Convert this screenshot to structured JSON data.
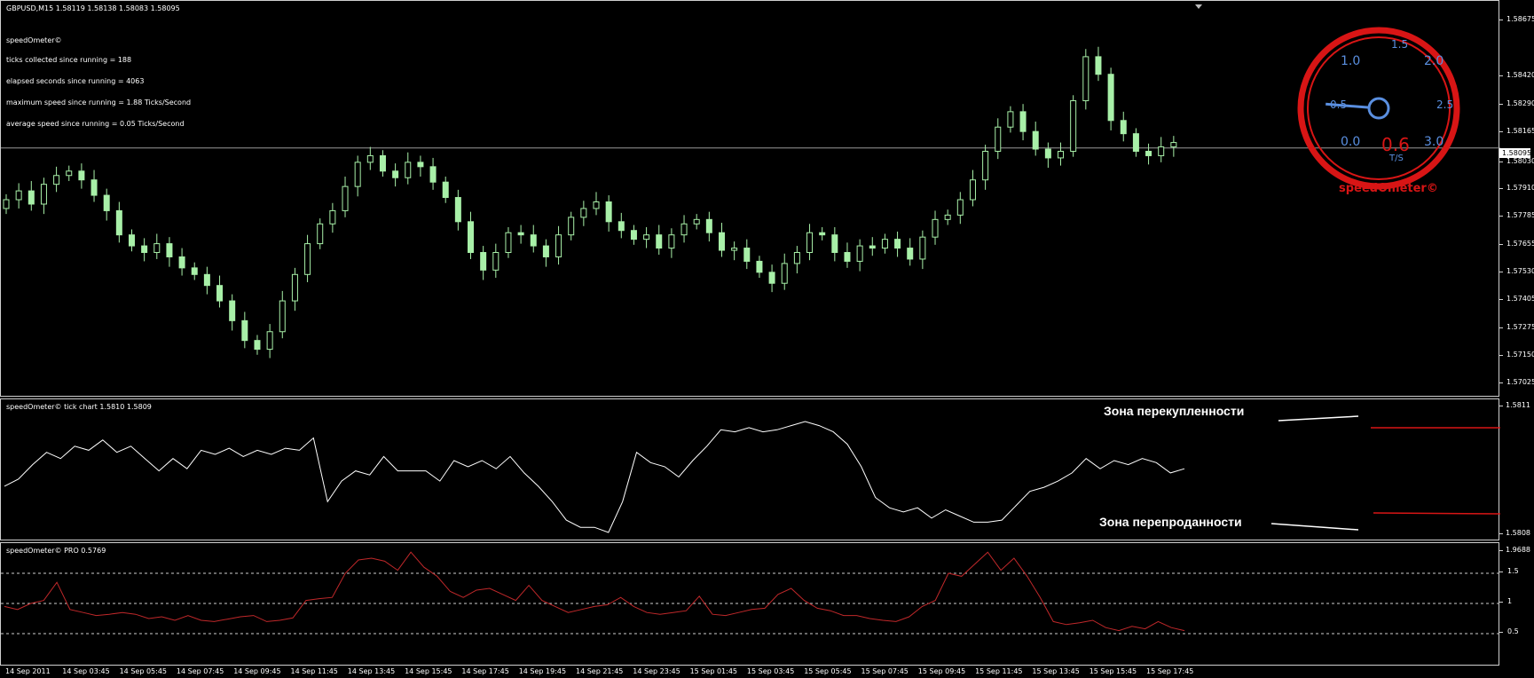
{
  "chart_data": [
    {
      "type": "candlestick",
      "title": "GBPUSD,M15  1.58119 1.58138 1.58083 1.58095",
      "current_price": "1.58095",
      "price_scale": [
        "1.58675",
        "1.58420",
        "1.58290",
        "1.58165",
        "1.58030",
        "1.57910",
        "1.57785",
        "1.57655",
        "1.57530",
        "1.57405",
        "1.57275",
        "1.57150",
        "1.57025"
      ],
      "close_series": [
        1.5786,
        1.579,
        1.5784,
        1.5793,
        1.5797,
        1.5799,
        1.5795,
        1.5788,
        1.5781,
        1.577,
        1.5765,
        1.5762,
        1.5766,
        1.576,
        1.5755,
        1.5752,
        1.5747,
        1.574,
        1.5731,
        1.5722,
        1.5718,
        1.5726,
        1.574,
        1.5752,
        1.5766,
        1.5775,
        1.5781,
        1.5792,
        1.5803,
        1.5806,
        1.5799,
        1.5796,
        1.5803,
        1.5801,
        1.5794,
        1.5787,
        1.5776,
        1.5762,
        1.5754,
        1.5762,
        1.5771,
        1.577,
        1.5765,
        1.576,
        1.577,
        1.5778,
        1.5782,
        1.5785,
        1.5776,
        1.5772,
        1.5768,
        1.577,
        1.5764,
        1.577,
        1.5775,
        1.5777,
        1.5771,
        1.5763,
        1.5764,
        1.5758,
        1.5753,
        1.5748,
        1.5757,
        1.5762,
        1.5771,
        1.577,
        1.5762,
        1.5758,
        1.5765,
        1.5764,
        1.5768,
        1.5764,
        1.5759,
        1.5769,
        1.5777,
        1.5779,
        1.5786,
        1.5795,
        1.5808,
        1.5819,
        1.5826,
        1.5817,
        1.5809,
        1.5805,
        1.5808,
        1.5831,
        1.5851,
        1.5843,
        1.5822,
        1.5816,
        1.5808,
        1.5806,
        1.581,
        1.5812
      ],
      "panel_texts": [
        "speedOmeter©",
        "ticks collected since running = 188",
        "elapsed seconds since running = 4063",
        "maximum speed since running = 1.88 Ticks/Second",
        "average speed since running = 0.05 Ticks/Second"
      ]
    },
    {
      "type": "line",
      "title": "speedOmeter© tick chart 1.5810 1.5809",
      "scale": [
        "1.5811",
        "1.5808"
      ],
      "zone_overbought": "Зона перекупленности",
      "zone_oversold": "Зона перепроданности",
      "series": [
        {
          "values": [
            0.45,
            0.52,
            0.66,
            0.78,
            0.72,
            0.84,
            0.8,
            0.9,
            0.78,
            0.84,
            0.72,
            0.6,
            0.72,
            0.62,
            0.8,
            0.76,
            0.82,
            0.74,
            0.8,
            0.76,
            0.82,
            0.8,
            0.92,
            0.3,
            0.5,
            0.6,
            0.56,
            0.74,
            0.6,
            0.6,
            0.6,
            0.5,
            0.7,
            0.64,
            0.7,
            0.62,
            0.74,
            0.58,
            0.45,
            0.3,
            0.12,
            0.05,
            0.05,
            0.0,
            0.3,
            0.78,
            0.68,
            0.64,
            0.54,
            0.7,
            0.84,
            1.0,
            0.98,
            1.02,
            0.98,
            1.0,
            1.04,
            1.08,
            1.04,
            0.98,
            0.86,
            0.64,
            0.34,
            0.24,
            0.2,
            0.24,
            0.14,
            0.22,
            0.16,
            0.1,
            0.1,
            0.12,
            0.26,
            0.4,
            0.44,
            0.5,
            0.58,
            0.72,
            0.62,
            0.7,
            0.66,
            0.72,
            0.68,
            0.58,
            0.62
          ]
        }
      ]
    },
    {
      "type": "line",
      "title": "speedOmeter© PRO 0.5769",
      "scale": [
        "1.9688",
        "1.5",
        "1",
        "0.5"
      ],
      "series": [
        {
          "values": [
            0.95,
            0.9,
            1.0,
            1.05,
            1.35,
            0.9,
            0.85,
            0.8,
            0.82,
            0.85,
            0.82,
            0.75,
            0.78,
            0.72,
            0.8,
            0.72,
            0.7,
            0.74,
            0.78,
            0.8,
            0.7,
            0.72,
            0.76,
            1.05,
            1.08,
            1.1,
            1.5,
            1.72,
            1.75,
            1.7,
            1.55,
            1.85,
            1.6,
            1.45,
            1.2,
            1.1,
            1.22,
            1.25,
            1.15,
            1.05,
            1.3,
            1.05,
            0.95,
            0.85,
            0.9,
            0.95,
            0.98,
            1.1,
            0.95,
            0.85,
            0.82,
            0.85,
            0.88,
            1.12,
            0.82,
            0.8,
            0.85,
            0.9,
            0.92,
            1.15,
            1.25,
            1.05,
            0.92,
            0.88,
            0.8,
            0.8,
            0.75,
            0.72,
            0.7,
            0.78,
            0.95,
            1.05,
            1.5,
            1.45,
            1.65,
            1.85,
            1.55,
            1.75,
            1.45,
            1.1,
            0.7,
            0.65,
            0.68,
            0.72,
            0.6,
            0.55,
            0.62,
            0.58,
            0.7,
            0.6,
            0.55
          ]
        }
      ]
    }
  ],
  "time_axis": [
    "14 Sep 2011",
    "14 Sep 03:45",
    "14 Sep 05:45",
    "14 Sep 07:45",
    "14 Sep 09:45",
    "14 Sep 11:45",
    "14 Sep 13:45",
    "14 Sep 15:45",
    "14 Sep 17:45",
    "14 Sep 19:45",
    "14 Sep 21:45",
    "14 Sep 23:45",
    "15 Sep 01:45",
    "15 Sep 03:45",
    "15 Sep 05:45",
    "15 Sep 07:45",
    "15 Sep 09:45",
    "15 Sep 11:45",
    "15 Sep 13:45",
    "15 Sep 15:45",
    "15 Sep 17:45"
  ],
  "gauge": {
    "labels": [
      "0.0",
      "0.5",
      "1.0",
      "1.5",
      "2.0",
      "2.5",
      "3.0"
    ],
    "value": "0.6",
    "unit": "T/S",
    "brand": "speedOmeter©",
    "needle_value": 0.55
  },
  "colors": {
    "candle": "#a8f0a8",
    "tick_line": "#ffffff",
    "pro_line": "#c0282a",
    "gauge_red": "#d81515",
    "gauge_blue": "#5a8fe0"
  }
}
